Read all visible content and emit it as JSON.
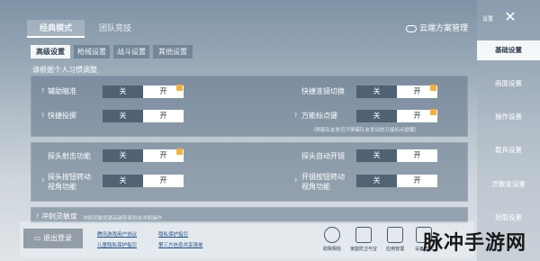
{
  "mode_tabs": [
    "经典模式",
    "团队竞技"
  ],
  "cloud_button": "云端方案管理",
  "sub_tabs": [
    "高级设置",
    "枪械设置",
    "战斗设置",
    "其他设置"
  ],
  "hint": "请根据个人习惯调整",
  "toggle_off": "关",
  "toggle_on": "开",
  "rows": {
    "aim_assist": "辅助瞄准",
    "quick_scope_switch": "快捷准镜切换",
    "quick_throw": "快捷投掷",
    "universal_marker": "万能标点键",
    "universal_marker_note": "（屏蔽队友是否开屏蔽队友发出的万能标点提醒）",
    "peek_fire": "探头射击功能",
    "peek_auto_scope": "探头自动开镜",
    "peek_button_rotate": [
      "探头按钮转动",
      "视角功能"
    ],
    "scope_button_rotate": [
      "开镜按钮转动",
      "视角功能"
    ],
    "recoil_sensitivity": "冲刺灵敏度",
    "recoil_note": "冲刺灵敏度越高越容易射击冲刺操作"
  },
  "sidebar": {
    "label": "设置",
    "close": "✕",
    "items": [
      "基础设置",
      "画面设置",
      "操作设置",
      "载具设置",
      "灵敏度设置",
      "拾取设置"
    ]
  },
  "bottom": {
    "logout": "退出登录",
    "links": [
      "腾讯游戏用户协议",
      "隐私保护指引",
      "儿童隐私保护指引",
      "第三方信息共享清单"
    ],
    "icons": [
      {
        "name": "people-icon",
        "label": "助我相信"
      },
      {
        "name": "lock-icon",
        "label": "家庭防卫与宝"
      },
      {
        "name": "shield-icon",
        "label": "应用管理"
      },
      {
        "name": "info-icon",
        "label": "设备详情"
      }
    ]
  },
  "watermark": "脉冲手游网",
  "colors": {
    "badge": "#f0b23a",
    "active_tab": "#ffffff"
  }
}
